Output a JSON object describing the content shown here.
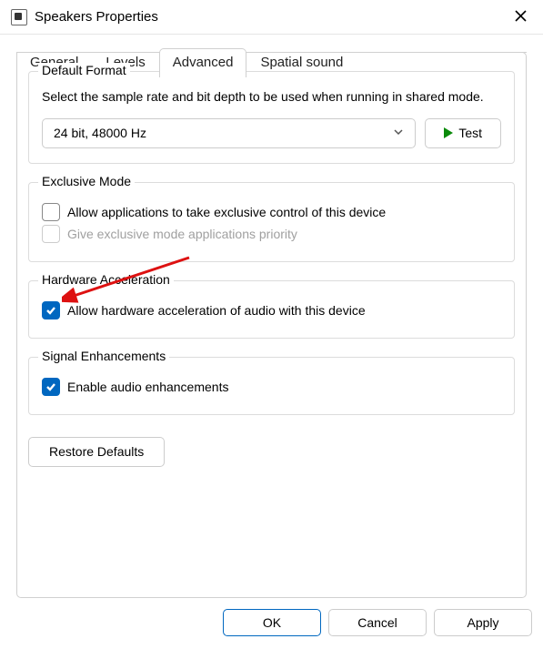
{
  "window": {
    "title": "Speakers Properties"
  },
  "tabs": [
    {
      "label": "General"
    },
    {
      "label": "Levels"
    },
    {
      "label": "Advanced"
    },
    {
      "label": "Spatial sound"
    }
  ],
  "default_format": {
    "legend": "Default Format",
    "description": "Select the sample rate and bit depth to be used when running in shared mode.",
    "selected": "24 bit, 48000 Hz",
    "test_label": "Test"
  },
  "exclusive_mode": {
    "legend": "Exclusive Mode",
    "allow_label": "Allow applications to take exclusive control of this device",
    "allow_checked": false,
    "priority_label": "Give exclusive mode applications priority",
    "priority_checked": false
  },
  "hw_accel": {
    "legend": "Hardware Acceleration",
    "allow_label": "Allow hardware acceleration of audio with this device",
    "allow_checked": true
  },
  "signal": {
    "legend": "Signal Enhancements",
    "enable_label": "Enable audio enhancements",
    "enable_checked": true
  },
  "restore_label": "Restore Defaults",
  "footer": {
    "ok": "OK",
    "cancel": "Cancel",
    "apply": "Apply"
  }
}
